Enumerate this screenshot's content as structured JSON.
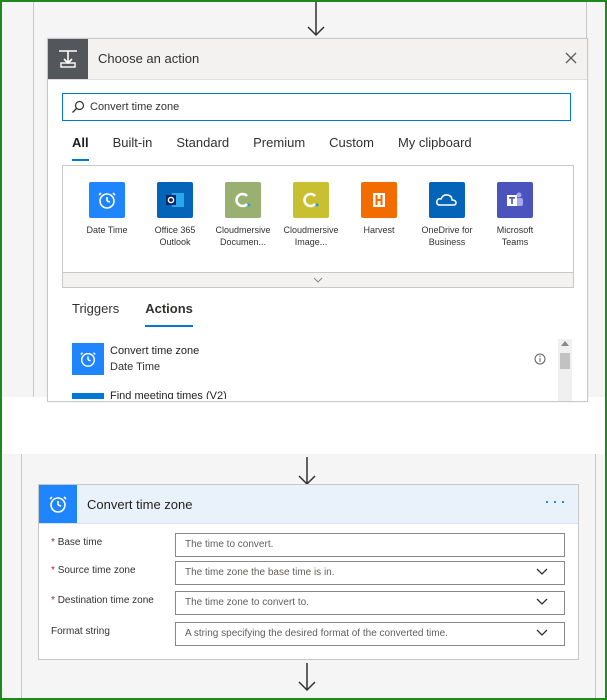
{
  "top": {
    "title": "Choose an action",
    "search": {
      "value": "Convert time zone",
      "placeholder": ""
    },
    "tabs": [
      "All",
      "Built-in",
      "Standard",
      "Premium",
      "Custom",
      "My clipboard"
    ],
    "connectors": [
      {
        "line1": "Date Time",
        "line2": "",
        "color": "#1f85ff",
        "icon": "clock-icon"
      },
      {
        "line1": "Office 365",
        "line2": "Outlook",
        "color": "#0364b8",
        "icon": "outlook-icon"
      },
      {
        "line1": "Cloudmersive",
        "line2": "Documen...",
        "color": "#9ab070",
        "icon": "cloudmersive-icon"
      },
      {
        "line1": "Cloudmersive",
        "line2": "Image...",
        "color": "#c8c030",
        "icon": "cloudmersive-icon"
      },
      {
        "line1": "Harvest",
        "line2": "",
        "color": "#f36c00",
        "icon": "harvest-icon"
      },
      {
        "line1": "OneDrive for",
        "line2": "Business",
        "color": "#0364b8",
        "icon": "onedrive-icon"
      },
      {
        "line1": "Microsoft",
        "line2": "Teams",
        "color": "#4b53bc",
        "icon": "teams-icon"
      }
    ],
    "subtabs": [
      "Triggers",
      "Actions"
    ],
    "actions": [
      {
        "title": "Convert time zone",
        "subtitle": "Date Time"
      },
      {
        "title": "Find meeting times (V2)",
        "subtitle": ""
      }
    ]
  },
  "bottom": {
    "title": "Convert time zone",
    "more": "···",
    "fields": [
      {
        "label": "Base time",
        "required": "*",
        "placeholder": "The time to convert.",
        "dropdown": false
      },
      {
        "label": "Source time zone",
        "required": "*",
        "placeholder": "The time zone the base time is in.",
        "dropdown": true
      },
      {
        "label": "Destination time zone",
        "required": "*",
        "placeholder": "The time zone to convert to.",
        "dropdown": true
      },
      {
        "label": "Format string",
        "required": "",
        "placeholder": "A string specifying the desired format of the converted time.",
        "dropdown": true
      }
    ]
  },
  "colors": {
    "accent": "#0078d4",
    "frame": "#1e8a1e",
    "action_blue": "#1f85ff"
  }
}
